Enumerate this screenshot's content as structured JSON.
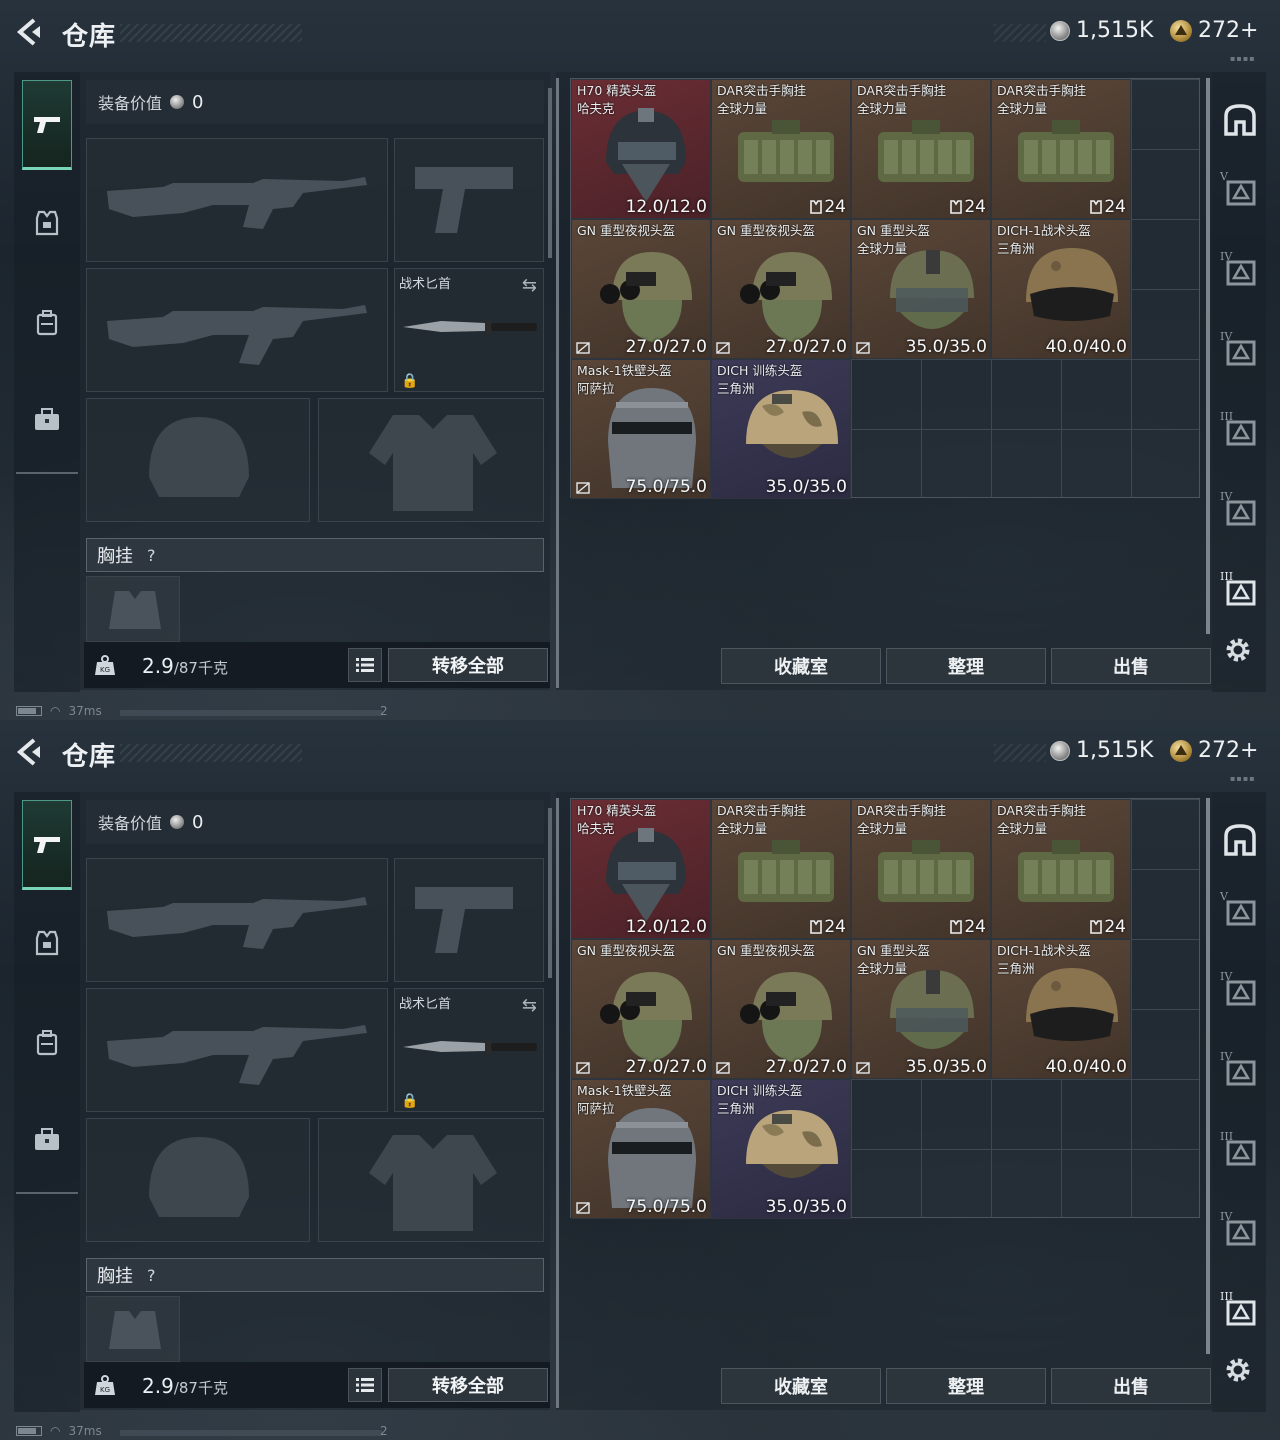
{
  "header": {
    "title": "仓库",
    "currency_silver": "1,515K",
    "currency_gold": "272+"
  },
  "equipment": {
    "value_label": "装备价值",
    "value": "0",
    "knife_label": "战术匕首",
    "rig_label": "胸挂",
    "rig_help": "?",
    "weight_current": "2.9",
    "weight_max": "/87千克",
    "transfer_all": "转移全部"
  },
  "items": [
    {
      "name": "H70 精英头盔",
      "sub": "哈夫克",
      "durability": "12.0/12.0",
      "bg": "red",
      "kind": "helmet-black"
    },
    {
      "name": "DAR突击手胸挂",
      "sub": "全球力量",
      "count": "24",
      "bg": "brown",
      "kind": "rig"
    },
    {
      "name": "DAR突击手胸挂",
      "sub": "全球力量",
      "count": "24",
      "bg": "brown",
      "kind": "rig"
    },
    {
      "name": "DAR突击手胸挂",
      "sub": "全球力量",
      "count": "24",
      "bg": "brown",
      "kind": "rig"
    },
    {
      "name": "GN 重型夜视头盔",
      "sub": "",
      "durability": "27.0/27.0",
      "bg": "brown",
      "kind": "helmet-nv",
      "noins": true
    },
    {
      "name": "GN 重型夜视头盔",
      "sub": "",
      "durability": "27.0/27.0",
      "bg": "brown",
      "kind": "helmet-nv",
      "noins": true
    },
    {
      "name": "GN 重型头盔",
      "sub": "全球力量",
      "durability": "35.0/35.0",
      "bg": "brown",
      "kind": "helmet-green",
      "noins": true
    },
    {
      "name": "DICH-1战术头盔",
      "sub": "三角洲",
      "durability": "40.0/40.0",
      "bg": "brown",
      "kind": "helmet-tan"
    },
    {
      "name": "Mask-1铁壁头盔",
      "sub": "阿萨拉",
      "durability": "75.0/75.0",
      "bg": "brown",
      "kind": "helmet-mask",
      "noins": true
    },
    {
      "name": "DICH 训练头盔",
      "sub": "三角洲",
      "durability": "35.0/35.0",
      "bg": "purple",
      "kind": "helmet-camo"
    }
  ],
  "buttons": {
    "collection": "收藏室",
    "sort": "整理",
    "sell": "出售"
  },
  "rail": {
    "tiers": [
      "",
      "V",
      "IV",
      "IV",
      "III",
      "IV",
      "III"
    ]
  },
  "status": {
    "ping": "37ms",
    "num": "2"
  },
  "colors": {
    "accent": "#7ad4b8",
    "rarity_red": "#6b2d34",
    "rarity_brown": "#5a4638",
    "rarity_purple": "#3c3a56"
  }
}
